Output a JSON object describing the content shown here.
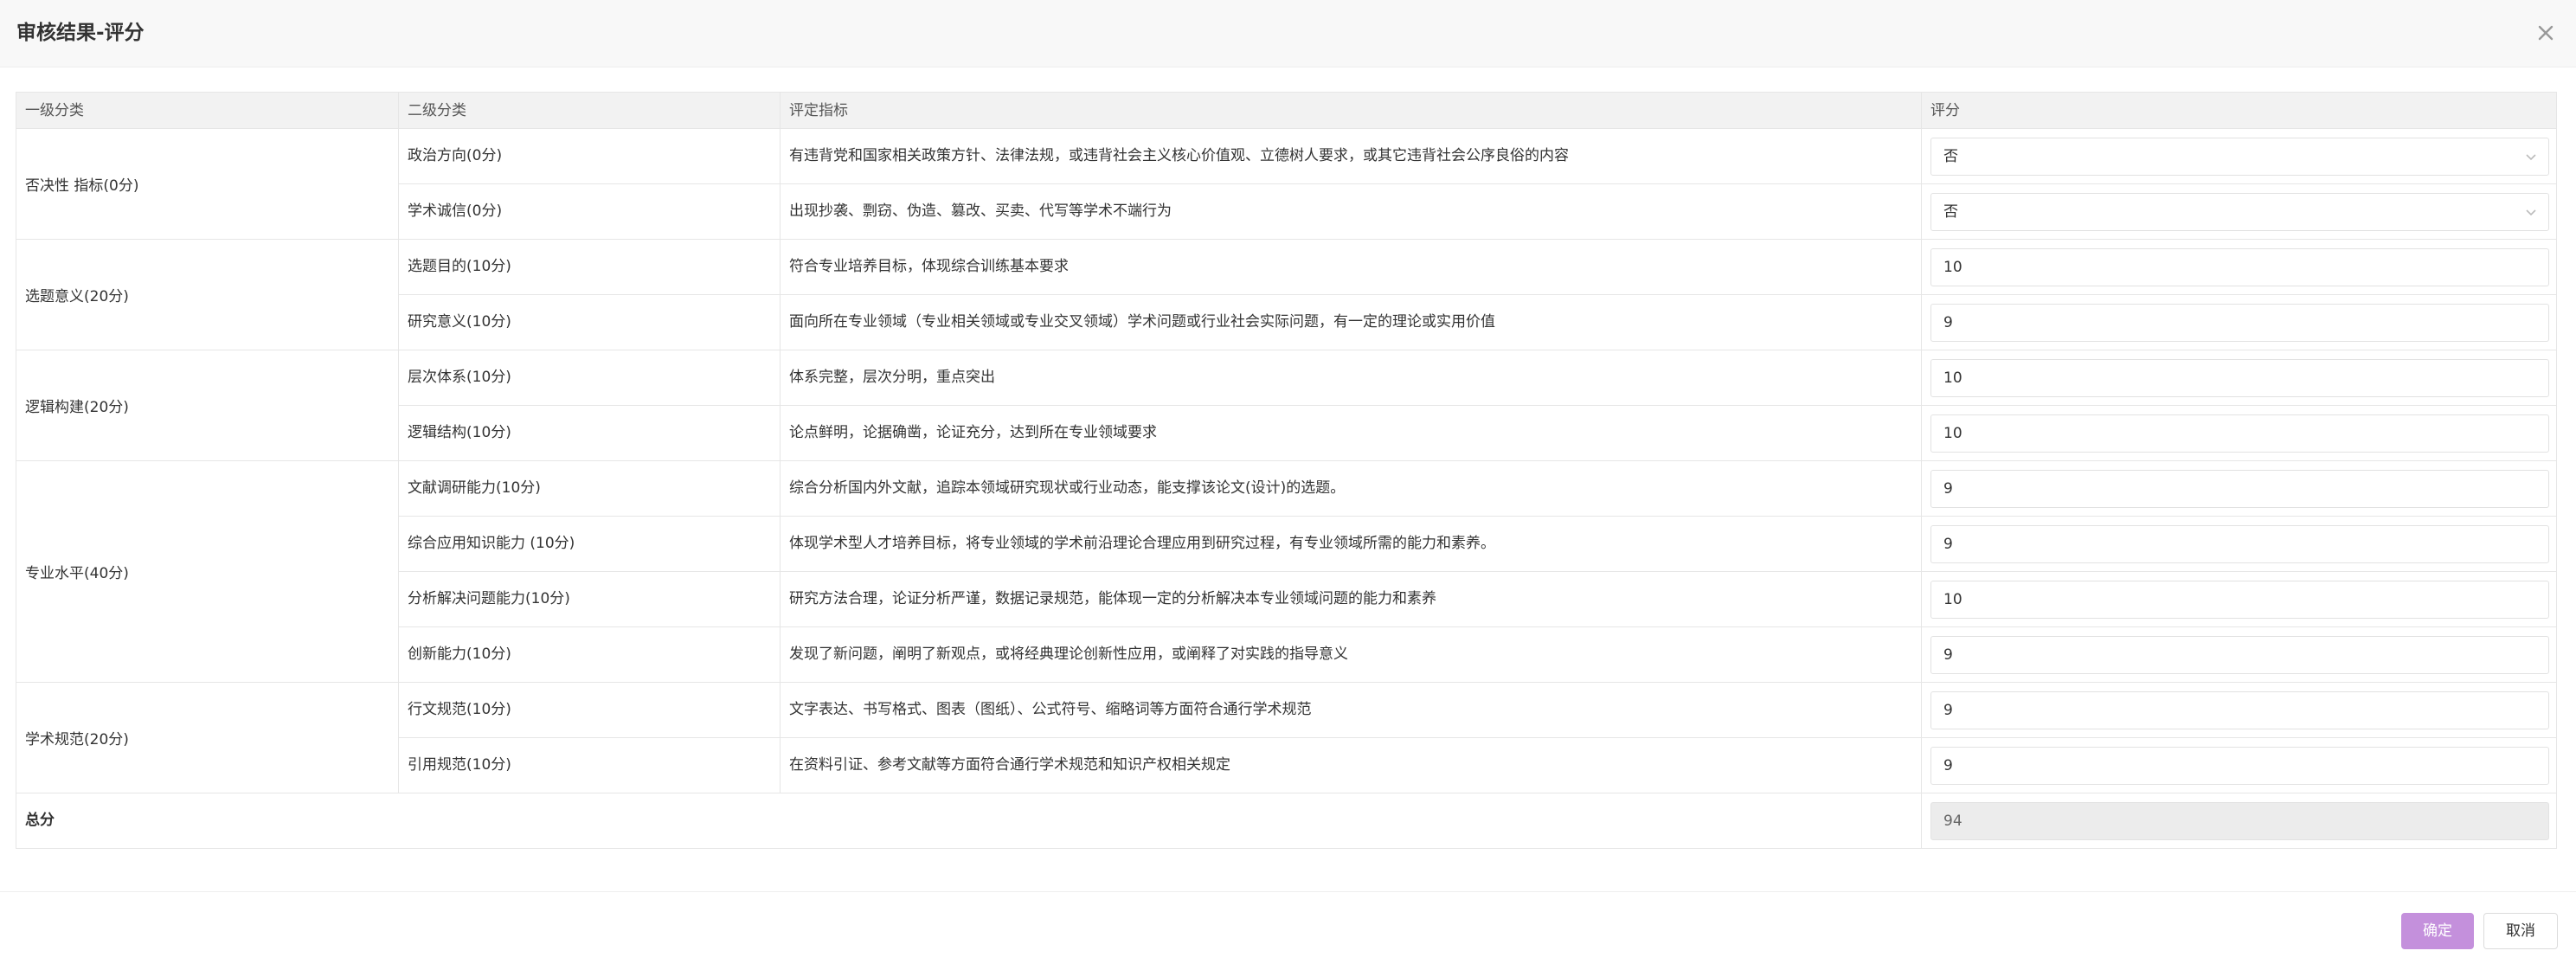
{
  "dialog": {
    "title": "审核结果-评分",
    "close_icon": "close-icon"
  },
  "table": {
    "headers": [
      "一级分类",
      "二级分类",
      "评定指标",
      "评分"
    ],
    "groups": [
      {
        "label": "否决性 指标(0分)"
      },
      {
        "label": "选题意义(20分)"
      },
      {
        "label": "逻辑构建(20分)"
      },
      {
        "label": "专业水平(40分)"
      },
      {
        "label": "学术规范(20分)"
      }
    ],
    "rows": [
      {
        "sub": "政治方向(0分)",
        "criteria": "有违背党和国家相关政策方针、法律法规，或违背社会主义核心价值观、立德树人要求，或其它违背社会公序良俗的内容",
        "score": "否"
      },
      {
        "sub": "学术诚信(0分)",
        "criteria": "出现抄袭、剽窃、伪造、篡改、买卖、代写等学术不端行为",
        "score": "否"
      },
      {
        "sub": "选题目的(10分)",
        "criteria": "符合专业培养目标，体现综合训练基本要求",
        "score": "10"
      },
      {
        "sub": "研究意义(10分)",
        "criteria": "面向所在专业领域（专业相关领域或专业交叉领域）学术问题或行业社会实际问题，有一定的理论或实用价值",
        "score": "9"
      },
      {
        "sub": "层次体系(10分)",
        "criteria": "体系完整，层次分明，重点突出",
        "score": "10"
      },
      {
        "sub": "逻辑结构(10分)",
        "criteria": "论点鲜明，论据确凿，论证充分，达到所在专业领域要求",
        "score": "10"
      },
      {
        "sub": "文献调研能力(10分)",
        "criteria": "综合分析国内外文献，追踪本领域研究现状或行业动态，能支撑该论文(设计)的选题。",
        "score": "9"
      },
      {
        "sub": "综合应用知识能力 (10分)",
        "criteria": "体现学术型人才培养目标，将专业领域的学术前沿理论合理应用到研究过程，有专业领域所需的能力和素养。",
        "score": "9"
      },
      {
        "sub": "分析解决问题能力(10分)",
        "criteria": "研究方法合理，论证分析严谨，数据记录规范，能体现一定的分析解决本专业领域问题的能力和素养",
        "score": "10"
      },
      {
        "sub": "创新能力(10分)",
        "criteria": "发现了新问题，阐明了新观点，或将经典理论创新性应用，或阐释了对实践的指导意义",
        "score": "9"
      },
      {
        "sub": "行文规范(10分)",
        "criteria": "文字表达、书写格式、图表（图纸）、公式符号、缩略词等方面符合通行学术规范",
        "score": "9"
      },
      {
        "sub": "引用规范(10分)",
        "criteria": "在资料引证、参考文献等方面符合通行学术规范和知识产权相关规定",
        "score": "9"
      }
    ],
    "total_label": "总分",
    "total_value": "94"
  },
  "footer": {
    "confirm_label": "确定",
    "cancel_label": "取消"
  },
  "colors": {
    "confirm_button": "#c490dc",
    "header_background": "#f2f2f2",
    "total_box_background": "#ececec"
  }
}
